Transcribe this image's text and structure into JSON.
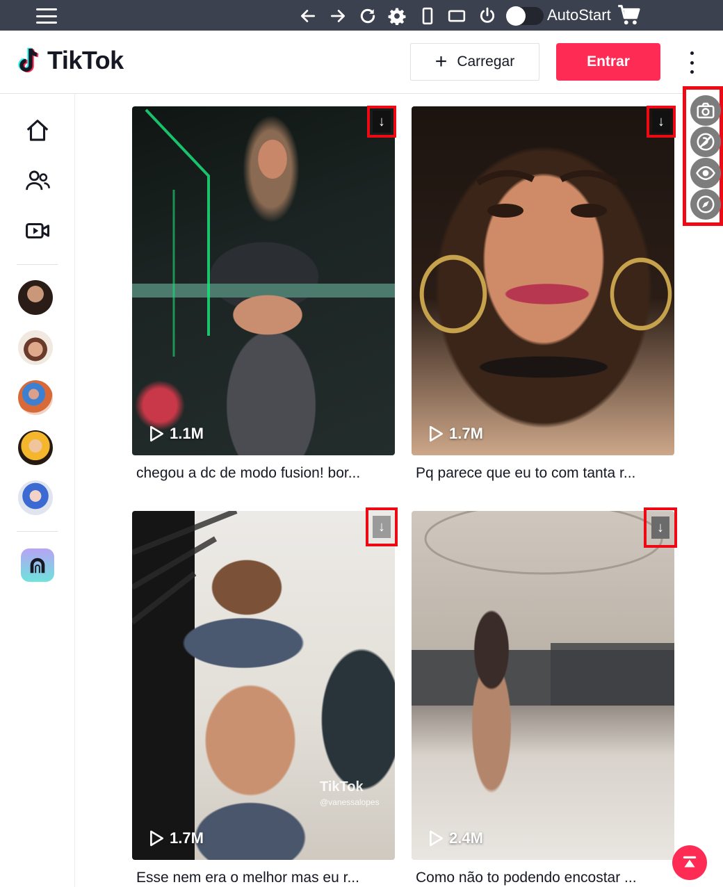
{
  "toolbar": {
    "autostart_label": "AutoStart",
    "icons": [
      "menu-icon",
      "back-arrow-icon",
      "forward-arrow-icon",
      "reload-icon",
      "settings-gear-icon",
      "phone-portrait-icon",
      "tablet-landscape-icon",
      "power-icon",
      "cart-icon"
    ]
  },
  "header": {
    "logo_text": "TikTok",
    "upload_label": "Carregar",
    "login_label": "Entrar"
  },
  "colors": {
    "accent": "#fe2c55",
    "toolbar_bg": "#3c4150",
    "highlight_border": "#ee0a14"
  },
  "sidebar": {
    "nav": [
      "home-icon",
      "following-icon",
      "live-icon"
    ],
    "avatars": 5
  },
  "videos": [
    {
      "views": "1.1M",
      "caption": "chegou a dc de modo fusion! bor..."
    },
    {
      "views": "1.7M",
      "caption": "Pq parece que eu to com tanta r..."
    },
    {
      "views": "1.7M",
      "caption": "Esse nem era o melhor mas eu r...",
      "watermark": "TikTok",
      "watermark_user": "@vanessalopes"
    },
    {
      "views": "2.4M",
      "caption": "Como não to podendo encostar ..."
    }
  ],
  "float_panel": [
    "camera-icon",
    "no-spy-icon",
    "eye-icon",
    "compass-icon"
  ]
}
